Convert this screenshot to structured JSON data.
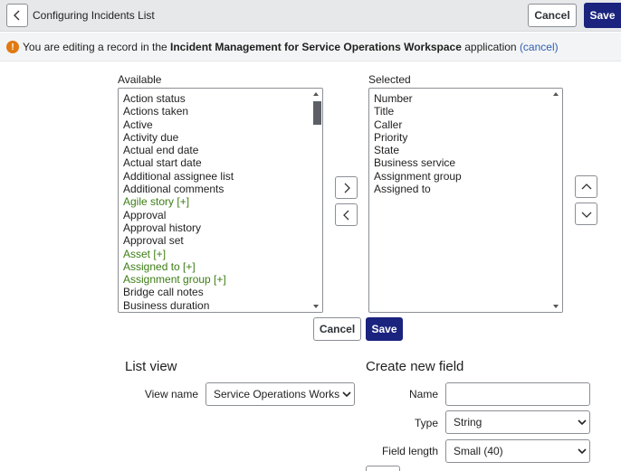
{
  "header": {
    "title": "Configuring Incidents List",
    "cancel_label": "Cancel",
    "save_label": "Save"
  },
  "notice": {
    "prefix": "You are editing a record in the ",
    "app_name": "Incident Management for Service Operations Workspace",
    "suffix": " application ",
    "cancel_link": "(cancel)"
  },
  "available": {
    "label": "Available",
    "items": [
      {
        "text": "Action status",
        "ref": false
      },
      {
        "text": "Actions taken",
        "ref": false
      },
      {
        "text": "Active",
        "ref": false
      },
      {
        "text": "Activity due",
        "ref": false
      },
      {
        "text": "Actual end date",
        "ref": false
      },
      {
        "text": "Actual start date",
        "ref": false
      },
      {
        "text": "Additional assignee list",
        "ref": false
      },
      {
        "text": "Additional comments",
        "ref": false
      },
      {
        "text": "Agile story [+]",
        "ref": true
      },
      {
        "text": "Approval",
        "ref": false
      },
      {
        "text": "Approval history",
        "ref": false
      },
      {
        "text": "Approval set",
        "ref": false
      },
      {
        "text": "Asset [+]",
        "ref": true
      },
      {
        "text": "Assigned to [+]",
        "ref": true
      },
      {
        "text": "Assignment group [+]",
        "ref": true
      },
      {
        "text": "Bridge call notes",
        "ref": false
      },
      {
        "text": "Business duration",
        "ref": false
      }
    ]
  },
  "selected": {
    "label": "Selected",
    "items": [
      "Number",
      "Title",
      "Caller",
      "Priority",
      "State",
      "Business service",
      "Assignment group",
      "Assigned to"
    ]
  },
  "list_actions": {
    "cancel_label": "Cancel",
    "save_label": "Save"
  },
  "list_view": {
    "title": "List view",
    "view_name_label": "View name",
    "view_name_value": "Service Operations Worksp"
  },
  "create_field": {
    "title": "Create new field",
    "name_label": "Name",
    "name_value": "",
    "type_label": "Type",
    "type_value": "String",
    "length_label": "Field length",
    "length_value": "Small (40)"
  },
  "colors": {
    "save_button": "#1a237e",
    "reference_field_text": "#3c7d14",
    "warning_icon": "#e07a12",
    "link": "#2f5fb3"
  }
}
